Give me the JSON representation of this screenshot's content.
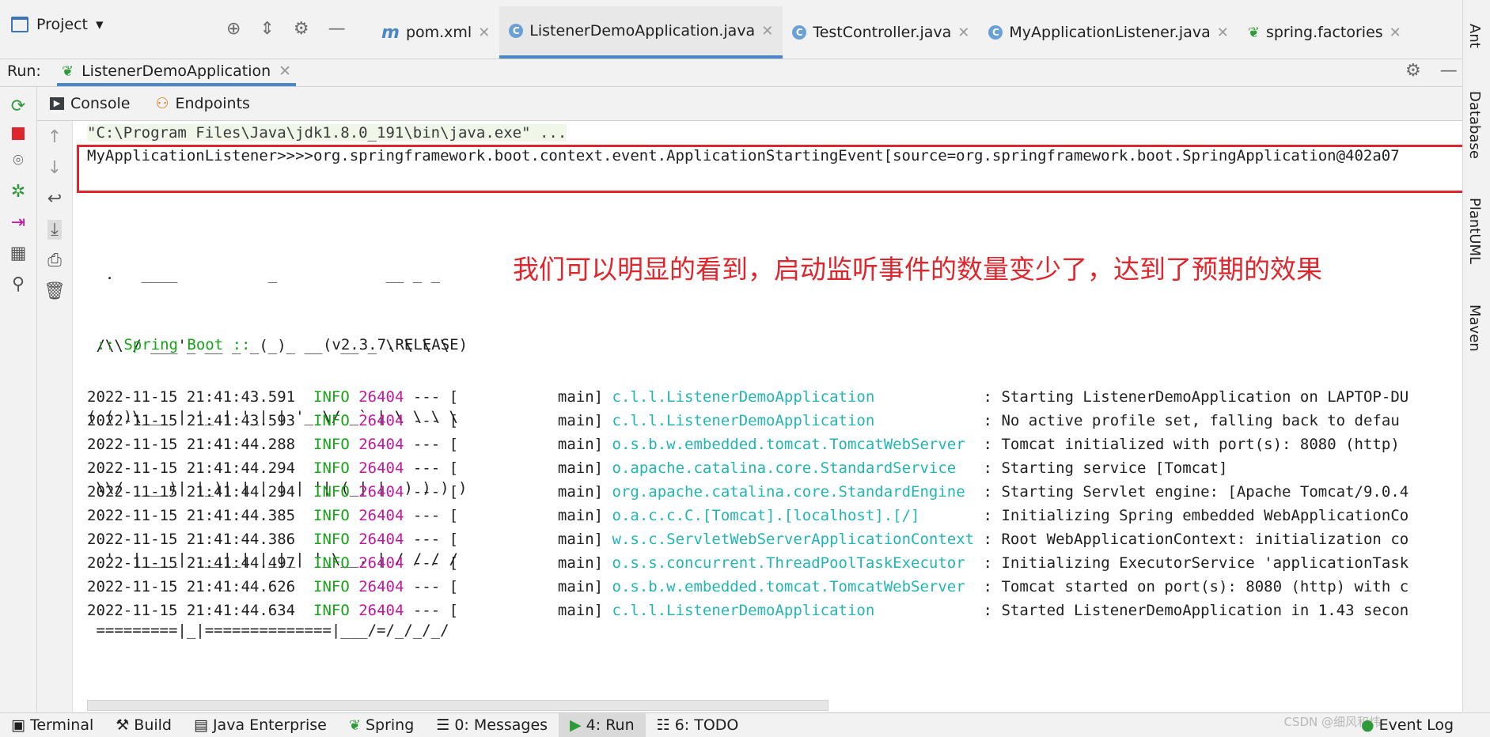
{
  "colors": {
    "accent": "#4a86c8",
    "highlight_box": "#e0262d",
    "info": "#17a317",
    "pid": "#c2189e",
    "logger": "#22b5b5"
  },
  "project_panel": {
    "title": "Project",
    "icons": [
      "crosshair-icon",
      "collapse-icon",
      "gear-icon",
      "minimize-icon"
    ]
  },
  "editor_tabs": [
    {
      "label": "pom.xml",
      "icon": "maven-icon"
    },
    {
      "label": "ListenerDemoApplication.java",
      "icon": "spring-class-icon",
      "active": true
    },
    {
      "label": "TestController.java",
      "icon": "class-icon"
    },
    {
      "label": "MyApplicationListener.java",
      "icon": "class-icon"
    },
    {
      "label": "spring.factories",
      "icon": "spring-leaf-icon"
    }
  ],
  "run": {
    "label": "Run:",
    "config": "ListenerDemoApplication"
  },
  "subtabs": {
    "console": "Console",
    "endpoints": "Endpoints"
  },
  "console": {
    "cmdline": "\"C:\\Program Files\\Java\\jdk1.8.0_191\\bin\\java.exe\" ...",
    "listener_line": "MyApplicationListener>>>>org.springframework.boot.context.event.ApplicationStartingEvent[source=org.springframework.boot.SpringApplication@402a07",
    "banner": [
      "  .   ____          _            __ _ _",
      " /\\\\ / ___'_ __ _ _(_)_ __  __ _ \\ \\ \\ \\",
      "( ( )\\___ | '_ | '_| | '_ \\/ _` | \\ \\ \\ \\",
      " \\\\/  ___)| |_)| | | | | || (_| |  ) ) ) )",
      "  '  |____| .__|_| |_|_| |_\\__, | / / / /",
      " =========|_|==============|___/=/_/_/_/"
    ],
    "spring_boot_label": ":: Spring Boot ::",
    "spring_boot_version": "(v2.3.7.RELEASE)",
    "annotation": "我们可以明显的看到，启动监听事件的数量变少了，达到了预期的效果",
    "logs": [
      {
        "ts": "2022-11-15 21:41:43.591",
        "level": "INFO",
        "pid": "26404",
        "thread": "main",
        "logger": "c.l.l.ListenerDemoApplication           ",
        "msg": "Starting ListenerDemoApplication on LAPTOP-DU"
      },
      {
        "ts": "2022-11-15 21:41:43.593",
        "level": "INFO",
        "pid": "26404",
        "thread": "main",
        "logger": "c.l.l.ListenerDemoApplication           ",
        "msg": "No active profile set, falling back to defau"
      },
      {
        "ts": "2022-11-15 21:41:44.288",
        "level": "INFO",
        "pid": "26404",
        "thread": "main",
        "logger": "o.s.b.w.embedded.tomcat.TomcatWebServer ",
        "msg": "Tomcat initialized with port(s): 8080 (http)"
      },
      {
        "ts": "2022-11-15 21:41:44.294",
        "level": "INFO",
        "pid": "26404",
        "thread": "main",
        "logger": "o.apache.catalina.core.StandardService  ",
        "msg": "Starting service [Tomcat]"
      },
      {
        "ts": "2022-11-15 21:41:44.294",
        "level": "INFO",
        "pid": "26404",
        "thread": "main",
        "logger": "org.apache.catalina.core.StandardEngine ",
        "msg": "Starting Servlet engine: [Apache Tomcat/9.0.4"
      },
      {
        "ts": "2022-11-15 21:41:44.385",
        "level": "INFO",
        "pid": "26404",
        "thread": "main",
        "logger": "o.a.c.c.C.[Tomcat].[localhost].[/]      ",
        "msg": "Initializing Spring embedded WebApplicationCo"
      },
      {
        "ts": "2022-11-15 21:41:44.386",
        "level": "INFO",
        "pid": "26404",
        "thread": "main",
        "logger": "w.s.c.ServletWebServerApplicationContext",
        "msg": "Root WebApplicationContext: initialization co"
      },
      {
        "ts": "2022-11-15 21:41:44.497",
        "level": "INFO",
        "pid": "26404",
        "thread": "main",
        "logger": "o.s.s.concurrent.ThreadPoolTaskExecutor ",
        "msg": "Initializing ExecutorService 'applicationTask"
      },
      {
        "ts": "2022-11-15 21:41:44.626",
        "level": "INFO",
        "pid": "26404",
        "thread": "main",
        "logger": "o.s.b.w.embedded.tomcat.TomcatWebServer ",
        "msg": "Tomcat started on port(s): 8080 (http) with c"
      },
      {
        "ts": "2022-11-15 21:41:44.634",
        "level": "INFO",
        "pid": "26404",
        "thread": "main",
        "logger": "c.l.l.ListenerDemoApplication           ",
        "msg": "Started ListenerDemoApplication in 1.43 secon"
      }
    ]
  },
  "right_tools": [
    "Ant",
    "Database",
    "PlantUML",
    "Maven"
  ],
  "status_tabs": [
    {
      "label": "Terminal",
      "icon": "terminal-icon"
    },
    {
      "label": "Build",
      "icon": "hammer-icon"
    },
    {
      "label": "Java Enterprise",
      "icon": "enterprise-icon"
    },
    {
      "label": "Spring",
      "icon": "spring-leaf-icon"
    },
    {
      "label": "0: Messages",
      "icon": "messages-icon"
    },
    {
      "label": "4: Run",
      "icon": "run-icon",
      "active": true
    },
    {
      "label": "6: TODO",
      "icon": "todo-icon"
    }
  ],
  "event_log": "Event Log",
  "watermark": "CSDN @细风和炜"
}
